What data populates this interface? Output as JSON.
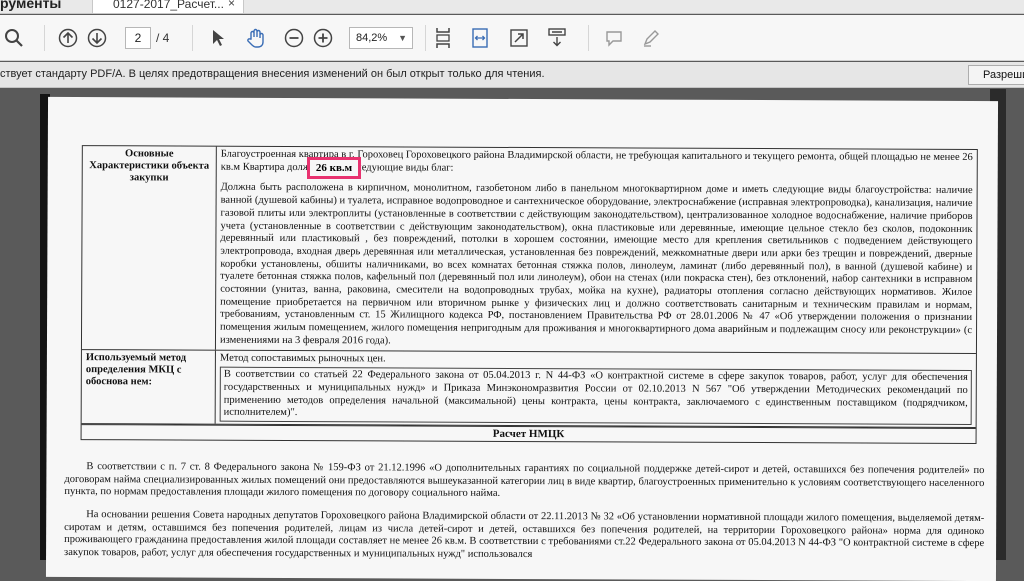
{
  "tabs": {
    "home_label": "рументы",
    "doc_label": "0127-2017_Расчет...",
    "close": "×"
  },
  "toolbar": {
    "page_current": "2",
    "page_total": "/ 4",
    "zoom": "84,2%",
    "zoom_caret": "▼"
  },
  "notice": {
    "text": "ствует стандарту PDF/A. В целях предотвращения внесения изменений он был открыт только для чтения.",
    "button": "Разреши"
  },
  "document": {
    "row1_label": "Основные Характеристики объекта закупки",
    "row1_p1": "Благоустроенная квартира в г. Гороховец Гороховецкого района Владимирской области, не требующая капитального и текущего ремонта, общей площадью не менее 26 кв.м Квартира должна иметь следующие виды благ:",
    "row1_p2": "Должна быть расположена в кирпичном, монолитном, газобетоном либо в панельном многоквартирном доме и иметь следующие виды благоустройства: наличие ванной (душевой кабины) и туалета, исправное водопроводное и сантехническое оборудование, электроснабжение (исправная электропроводка), канализация, наличие газовой плиты или электроплиты (установленные в соответствии с действующим законодательством), централизованное холодное водоснабжение, наличие приборов учета (установленные в соответствии с действующим законодательством), окна пластиковые или деревянные, имеющие цельное стекло без сколов, подоконник деревянный или пластиковый , без повреждений, потолки в хорошем состоянии, имеющие место для крепления светильников с подведением действующего электропровода, входная дверь деревянная или металлическая, установленная без повреждений, межкомнатные двери или арки без трещин и повреждений, дверные коробки установлены, обшиты наличниками, во всех комнатах бетонная стяжка полов, линолеум, ламинат (либо деревянный пол), в ванной (душевой кабине) и туалете бетонная стяжка полов, кафельный пол (деревянный пол или линолеум), обои на стенах (или покраска стен), без отклонений, набор сантехники в исправном состоянии (унитаз, ванна, раковина, смесители на водопроводных трубах, мойка на кухне), радиаторы отопления согласно действующих нормативов. Жилое помещение приобретается на первичном или вторичном рынке у физических лиц и должно соответствовать санитарным и техническим правилам и нормам, требованиям, установленным ст. 15 Жилищного кодекса РФ, постановлением Правительства РФ от 28.01.2006 № 47 «Об утверждении положения о признании помещения жилым помещением, жилого помещения непригодным для проживания и многоквартирного дома аварийным и подлежащим сносу или реконструкции» (с изменениями на 3 февраля 2016 года).",
    "row2_label": "Используемый метод определения МКЦ с обоснова нем:",
    "row2_p1": "Метод сопоставимых рыночных цен.",
    "row2_p2": "В соответствии со статьей 22 Федерального закона от 05.04.2013 г. N 44-ФЗ «О контрактной системе в сфере закупок товаров, работ, услуг для обеспечения государственных и муниципальных нужд» и Приказа Минэкономразвития России от 02.10.2013 N 567 \"Об утверждении Методических рекомендаций по применению методов определения начальной (максимальной) цены контракта, цены контракта, заключаемого с единственным поставщиком (подрядчиком, исполнителем)\".",
    "calc_title": "Расчет НМЦК",
    "body1": "В соответствии с п. 7 ст. 8 Федерального закона № 159-ФЗ от 21.12.1996 «О дополнительных гарантиях по социальной поддержке детей-сирот и детей, оставшихся без попечения родителей» по договорам найма специализированных жилых помещений они предоставляются вышеуказанной категории лиц в виде квартир, благоустроенных применительно к условиям соответствующего населенного пункта, по нормам предоставления площади жилого помещения по договору социального найма.",
    "body2": "На основании решения Совета народных депутатов Гороховецкого района Владимирской области от 22.11.2013 № 32 «Об установлении нормативной площади жилого помещения, выделяемой детям-сиротам и детям, оставшимся без попечения родителей, лицам из числа детей-сирот и детей, оставшихся без попечения родителей, на территории Гороховецкого района» норма для одиноко проживающего гражданина предоставления жилой площади составляет не менее 26 кв.м. В соответствии с требованиями ст.22 Федерального закона от 05.04.2013 N 44-ФЗ \"О контрактной системе в сфере закупок товаров, работ, услуг для обеспечения государственных и муниципальных нужд\" использовался",
    "highlight": "26 кв.м"
  }
}
